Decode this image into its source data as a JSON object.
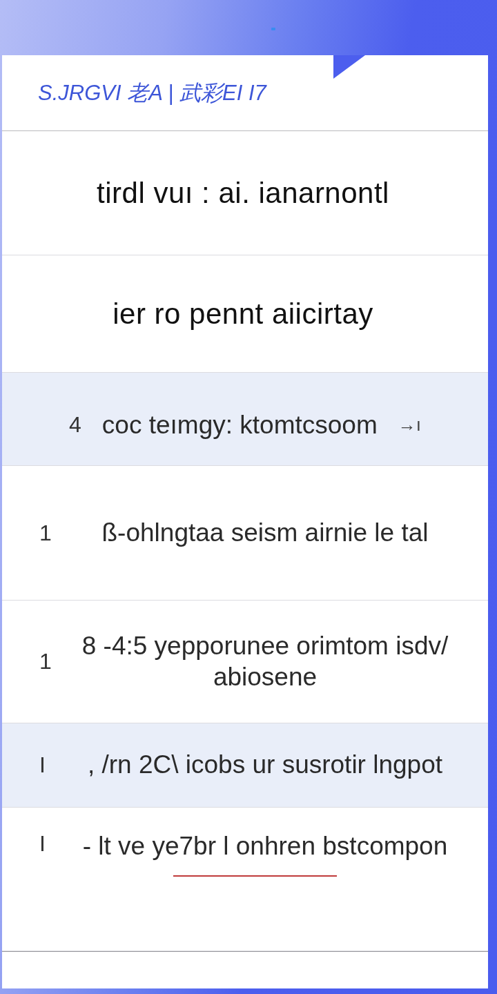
{
  "header": {
    "title": "S.JRGVI 老A | 武彩EI I7"
  },
  "rows": [
    {
      "kind": "heading",
      "text": "tirdl vuı : ai. ianarnontl",
      "selected": false,
      "underline": false
    },
    {
      "kind": "heading",
      "text": "ier ro pennt aiicirtay",
      "selected": false,
      "underline": false
    },
    {
      "kind": "centered",
      "index": "4",
      "text": "coc teımgy: ktomtcsoom",
      "trailing": "→ı",
      "selected": true,
      "underline": false
    },
    {
      "kind": "numbered",
      "index": "1",
      "text": "ß-ohlngtaa seism airnie le tal",
      "selected": false,
      "underline": false
    },
    {
      "kind": "numbered",
      "index": "1",
      "text": "8 -4:5 yepporunee orimtom isdv/ abiosene",
      "selected": false,
      "underline": false
    },
    {
      "kind": "numbered",
      "index": "I",
      "text": ", /rn 2C\\ icobs ur susrotir lngpot",
      "selected": true,
      "underline": false
    },
    {
      "kind": "numbered",
      "index": "I",
      "text": "- lt ve ye7br l onhren bstcompon",
      "selected": false,
      "underline": true
    }
  ]
}
